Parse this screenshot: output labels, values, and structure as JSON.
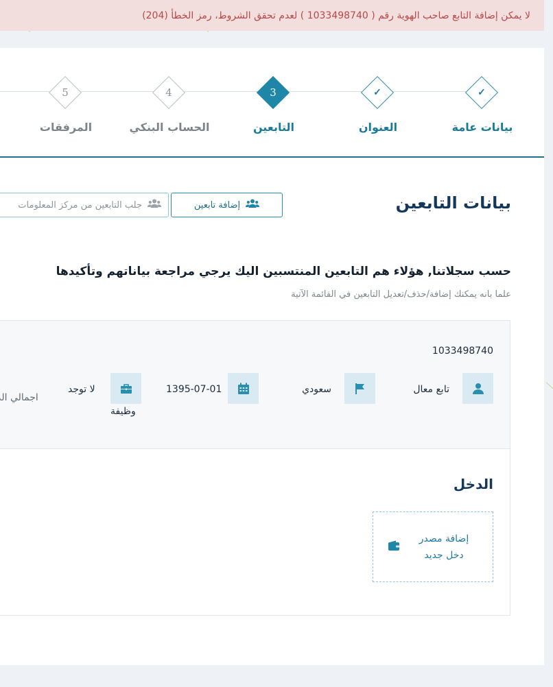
{
  "error_message": "لا يمكن إضافة التابع صاحب الهوية رقم ( 1033498740 ) لعدم تحقق الشروط، رمز الخطأ (204)",
  "stepper": {
    "steps": [
      {
        "label": "بيانات عامة",
        "marker": "✓",
        "state": "done"
      },
      {
        "label": "العنوان",
        "marker": "✓",
        "state": "done"
      },
      {
        "label": "التابعين",
        "marker": "3",
        "state": "active"
      },
      {
        "label": "الحساب البنكي",
        "marker": "4",
        "state": "pending"
      },
      {
        "label": "المرفقات",
        "marker": "5",
        "state": "pending"
      }
    ]
  },
  "section": {
    "title": "بيانات التابعين",
    "add_button": "إضافة تابعين",
    "fetch_button": "جلب التابعين من مركز المعلومات"
  },
  "intro": {
    "title": "حسب سجلاتنا, هؤلاء هم التابعين المنتسبين اليك يرجي مراجعة بياناتهم وتأكيدها",
    "subtitle": "علما بانه يمكنك إضافة/حذف/تعديل التابعين في القائمة الآتية"
  },
  "dependent": {
    "id_number": "1033498740",
    "status": "تابع معال",
    "nationality": "سعودي",
    "birth_date": "1395-07-01",
    "job_value": "لا توجد",
    "job_label": "وظيفة",
    "total_label": "اجمالي الد"
  },
  "income": {
    "title": "الدخل",
    "add_line1": "إضافة مصدر",
    "add_line2": "دخل جديد"
  },
  "colors": {
    "accent": "#1f86a8",
    "error_bg": "#f3dede",
    "error_text": "#b84848",
    "title": "#14385a"
  },
  "icons": {
    "status": "user-icon",
    "nationality": "flag-icon",
    "birth_date": "calendar-icon",
    "job": "briefcase-icon",
    "add_dependents": "users-icon",
    "fetch_dependents": "users-icon",
    "income": "wallet-icon"
  }
}
